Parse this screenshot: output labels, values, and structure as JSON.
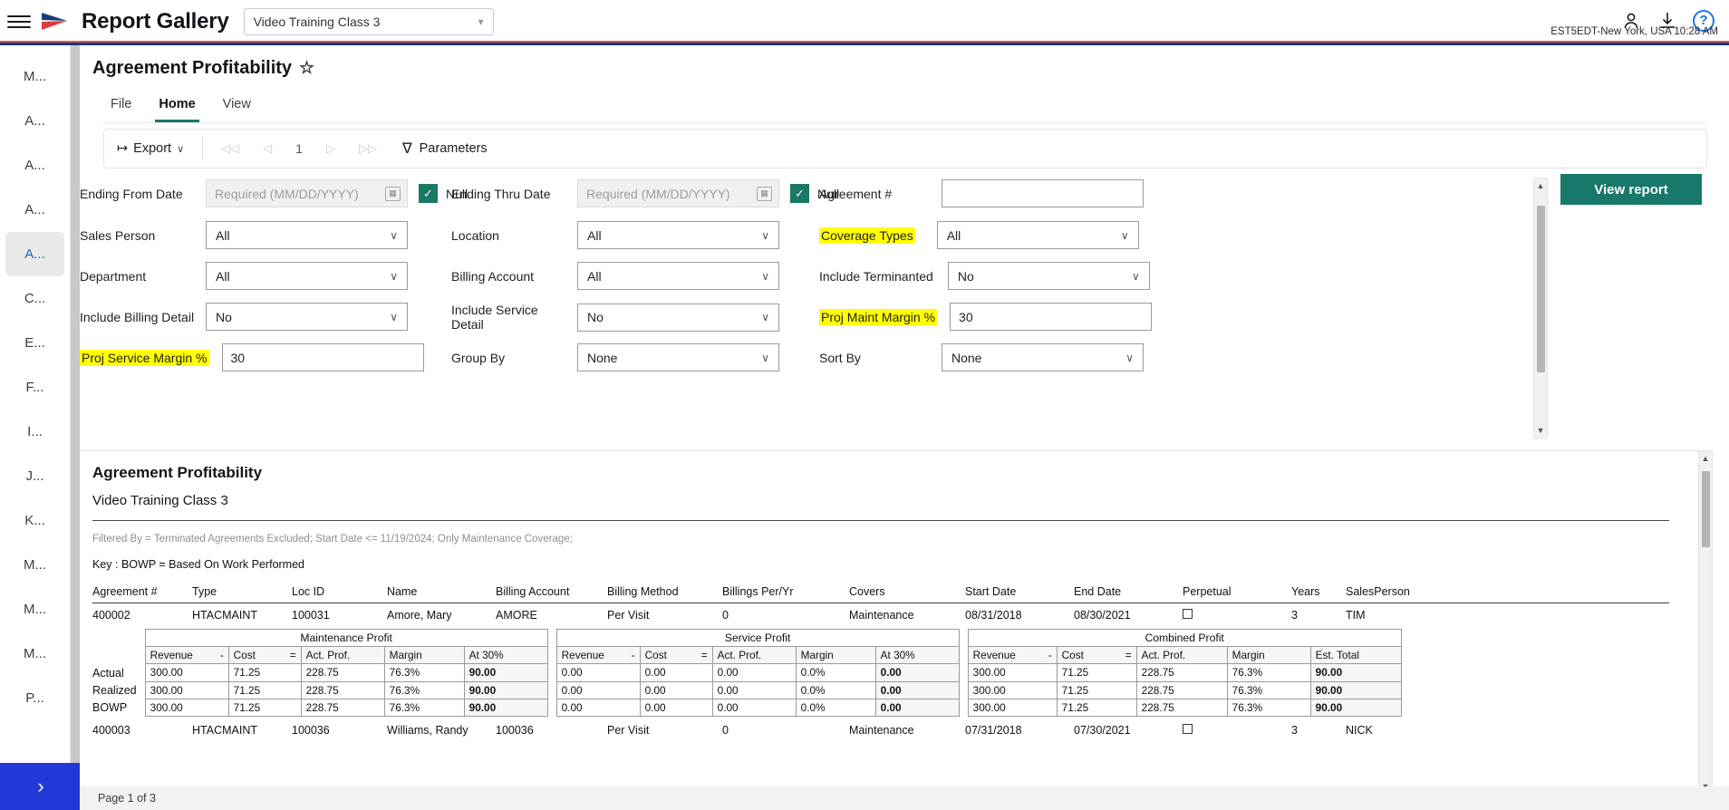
{
  "header": {
    "brand": "Report Gallery",
    "menu_icon": "hamburger-icon",
    "context_value": "Video Training Class 3",
    "account_icon": "person-icon",
    "download_icon": "download-icon",
    "help_icon": "help-icon",
    "help_glyph": "?",
    "timezone": "EST5EDT-New York, USA 10:28 AM"
  },
  "sidebar": {
    "items": [
      {
        "label": "M...",
        "active": false
      },
      {
        "label": "A...",
        "active": false
      },
      {
        "label": "A...",
        "active": false
      },
      {
        "label": "A...",
        "active": false
      },
      {
        "label": "A...",
        "active": true
      },
      {
        "label": "C...",
        "active": false
      },
      {
        "label": "E...",
        "active": false
      },
      {
        "label": "F...",
        "active": false
      },
      {
        "label": "I...",
        "active": false
      },
      {
        "label": "J...",
        "active": false
      },
      {
        "label": "K...",
        "active": false
      },
      {
        "label": "M...",
        "active": false
      },
      {
        "label": "M...",
        "active": false
      },
      {
        "label": "M...",
        "active": false
      },
      {
        "label": "P...",
        "active": false
      }
    ],
    "expand_glyph": "›"
  },
  "report": {
    "title": "Agreement Profitability",
    "star_glyph": "☆",
    "tabs": [
      {
        "label": "File",
        "active": false
      },
      {
        "label": "Home",
        "active": true
      },
      {
        "label": "View",
        "active": false
      }
    ],
    "toolbar": {
      "export_label": "Export",
      "export_glyph": "↦",
      "chevron_glyph": "∨",
      "nav_first": "◁◁",
      "nav_prev": "◁",
      "page_number": "1",
      "nav_next": "▷",
      "nav_last": "▷▷",
      "parameters_label": "Parameters",
      "funnel_glyph": "∇"
    }
  },
  "parameters": {
    "view_report_label": "View report",
    "null_label": "Null",
    "check_glyph": "✓",
    "chevron_glyph": "∨",
    "date_placeholder": "Required (MM/DD/YYYY)",
    "fields": [
      {
        "label": "Ending From Date",
        "value": "",
        "type": "date",
        "highlight": false,
        "null_checked": true
      },
      {
        "label": "Ending Thru Date",
        "value": "",
        "type": "date",
        "highlight": false,
        "null_checked": true
      },
      {
        "label": "Agreement #",
        "value": "",
        "type": "text",
        "highlight": false
      },
      {
        "label": "Sales Person",
        "value": "All",
        "type": "select",
        "highlight": false
      },
      {
        "label": "Location",
        "value": "All",
        "type": "select",
        "highlight": false
      },
      {
        "label": "Coverage Types",
        "value": "All",
        "type": "select",
        "highlight": true
      },
      {
        "label": "Department",
        "value": "All",
        "type": "select",
        "highlight": false
      },
      {
        "label": "Billing Account",
        "value": "All",
        "type": "select",
        "highlight": false
      },
      {
        "label": "Include Terminanted",
        "value": "No",
        "type": "select",
        "highlight": false
      },
      {
        "label": "Include Billing Detail",
        "value": "No",
        "type": "select",
        "highlight": false
      },
      {
        "label": "Include Service Detail",
        "value": "No",
        "type": "select",
        "highlight": false
      },
      {
        "label": "Proj Maint Margin %",
        "value": "30",
        "type": "text",
        "highlight": true
      },
      {
        "label": "Proj Service Margin %",
        "value": "30",
        "type": "text",
        "highlight": true
      },
      {
        "label": "Group By",
        "value": "None",
        "type": "select",
        "highlight": false
      },
      {
        "label": "Sort By",
        "value": "None",
        "type": "select",
        "highlight": false
      }
    ]
  },
  "report_body": {
    "title": "Agreement Profitability",
    "subtitle": "Video Training Class 3",
    "filtered_by": "Filtered By = Terminated Agreements Excluded; Start Date <= 11/19/2024; Only Maintenance Coverage;",
    "key_text": "Key : BOWP = Based On Work Performed",
    "columns": [
      "Agreement #",
      "Type",
      "Loc ID",
      "Name",
      "Billing Account",
      "Billing Method",
      "Billings Per/Yr",
      "Covers",
      "Start Date",
      "End Date",
      "Perpetual",
      "Years",
      "SalesPerson"
    ],
    "row1": {
      "agreement": "400002",
      "type": "HTACMAINT",
      "loc_id": "100031",
      "name": "Amore, Mary",
      "billing_account": "AMORE",
      "billing_method": "Per Visit",
      "billings_per_yr": "0",
      "covers": "Maintenance",
      "start_date": "08/31/2018",
      "end_date": "08/30/2021",
      "perpetual": "",
      "years": "3",
      "salesperson": "TIM"
    },
    "row2": {
      "agreement": "400003",
      "type": "HTACMAINT",
      "loc_id": "100036",
      "name": "Williams, Randy",
      "billing_account": "100036",
      "billing_method": "Per Visit",
      "billings_per_yr": "0",
      "covers": "Maintenance",
      "start_date": "07/31/2018",
      "end_date": "07/30/2021",
      "perpetual": "",
      "years": "3",
      "salesperson": "NICK"
    },
    "row_labels": [
      "Actual",
      "Realized",
      "BOWP"
    ],
    "profit_tables": [
      {
        "title": "Maintenance Profit",
        "columns": [
          "Revenue",
          "Cost",
          "Act. Prof.",
          "Margin",
          "At 30%"
        ],
        "ops": [
          "-",
          "=",
          "",
          "",
          ""
        ],
        "rows": [
          [
            "300.00",
            "71.25",
            "228.75",
            "76.3%",
            "90.00"
          ],
          [
            "300.00",
            "71.25",
            "228.75",
            "76.3%",
            "90.00"
          ],
          [
            "300.00",
            "71.25",
            "228.75",
            "76.3%",
            "90.00"
          ]
        ]
      },
      {
        "title": "Service Profit",
        "columns": [
          "Revenue",
          "Cost",
          "Act. Prof.",
          "Margin",
          "At 30%"
        ],
        "ops": [
          "-",
          "=",
          "",
          "",
          ""
        ],
        "rows": [
          [
            "0.00",
            "0.00",
            "0.00",
            "0.0%",
            "0.00"
          ],
          [
            "0.00",
            "0.00",
            "0.00",
            "0.0%",
            "0.00"
          ],
          [
            "0.00",
            "0.00",
            "0.00",
            "0.0%",
            "0.00"
          ]
        ]
      },
      {
        "title": "Combined Profit",
        "columns": [
          "Revenue",
          "Cost",
          "Act. Prof.",
          "Margin",
          "Est. Total"
        ],
        "ops": [
          "-",
          "=",
          "",
          "",
          ""
        ],
        "rows": [
          [
            "300.00",
            "71.25",
            "228.75",
            "76.3%",
            "90.00"
          ],
          [
            "300.00",
            "71.25",
            "228.75",
            "76.3%",
            "90.00"
          ],
          [
            "300.00",
            "71.25",
            "228.75",
            "76.3%",
            "90.00"
          ]
        ]
      }
    ]
  },
  "status": {
    "page_label": "Page 1 of 3"
  },
  "colors": {
    "accent_teal": "#18796b",
    "highlight_yellow": "#ffff00",
    "sidebar_active_blue": "#2a5db0",
    "expand_blue": "#2437d8",
    "stripe_red": "#e4525a",
    "stripe_blue": "#1a3a7a"
  }
}
